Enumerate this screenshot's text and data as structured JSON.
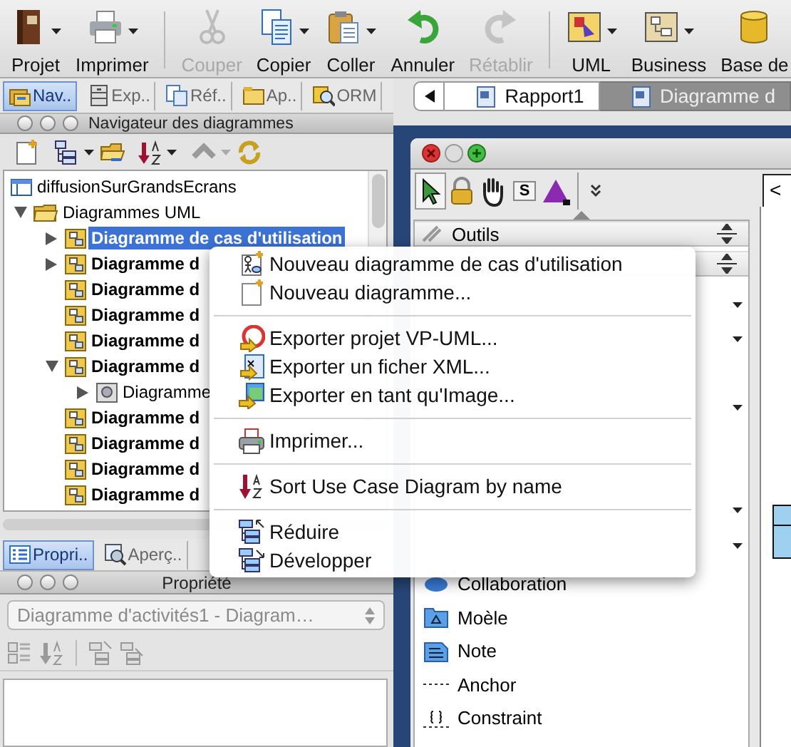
{
  "toolbar": {
    "items": [
      {
        "kind": "button",
        "label": "Projet",
        "disabled": false,
        "dropdown": true
      },
      {
        "kind": "button",
        "label": "Imprimer",
        "disabled": false,
        "dropdown": true
      },
      {
        "kind": "separator"
      },
      {
        "kind": "button",
        "label": "Couper",
        "disabled": true,
        "dropdown": false
      },
      {
        "kind": "button",
        "label": "Copier",
        "disabled": false,
        "dropdown": true
      },
      {
        "kind": "button",
        "label": "Coller",
        "disabled": false,
        "dropdown": true
      },
      {
        "kind": "button",
        "label": "Annuler",
        "disabled": false,
        "dropdown": false
      },
      {
        "kind": "button",
        "label": "Rétablir",
        "disabled": true,
        "dropdown": false
      },
      {
        "kind": "separator"
      },
      {
        "kind": "button",
        "label": "UML",
        "disabled": false,
        "dropdown": true
      },
      {
        "kind": "button",
        "label": "Business",
        "disabled": false,
        "dropdown": true
      },
      {
        "kind": "button",
        "label": "Base de",
        "disabled": false,
        "dropdown": false
      }
    ]
  },
  "panel_tabs": [
    {
      "label": "Nav..",
      "selected": true
    },
    {
      "label": "Exp..",
      "selected": false
    },
    {
      "label": "Réf..",
      "selected": false
    },
    {
      "label": "Ap..",
      "selected": false
    },
    {
      "label": "ORM",
      "selected": false
    }
  ],
  "document_tabs": [
    {
      "label": "Rapport1",
      "selected": false
    },
    {
      "label": "Diagramme d",
      "selected": true
    }
  ],
  "navigator": {
    "title": "Navigateur des diagrammes",
    "tree": [
      {
        "kind": "project",
        "label": "diffusionSurGrandsEcrans",
        "selected": false,
        "children": [
          {
            "kind": "folder",
            "label": "Diagrammes UML",
            "expandable": true,
            "expanded": true,
            "selected": false,
            "children": [
              {
                "kind": "category",
                "label": "Diagramme de cas d'utilisation",
                "expandable": true,
                "expanded": false,
                "selected": true
              },
              {
                "kind": "category",
                "label": "Diagramme d",
                "expandable": true,
                "expanded": false,
                "selected": false
              },
              {
                "kind": "category",
                "label": "Diagramme d",
                "expandable": false,
                "expanded": false,
                "selected": false
              },
              {
                "kind": "category",
                "label": "Diagramme d",
                "expandable": false,
                "expanded": false,
                "selected": false
              },
              {
                "kind": "category",
                "label": "Diagramme d",
                "expandable": false,
                "expanded": false,
                "selected": false
              },
              {
                "kind": "category",
                "label": "Diagramme d",
                "expandable": true,
                "expanded": true,
                "selected": false,
                "children": [
                  {
                    "kind": "diagram",
                    "label": "Diagramme",
                    "expandable": true,
                    "expanded": false,
                    "selected": false
                  }
                ]
              },
              {
                "kind": "category",
                "label": "Diagramme d",
                "expandable": false,
                "expanded": false,
                "selected": false
              },
              {
                "kind": "category",
                "label": "Diagramme d",
                "expandable": false,
                "expanded": false,
                "selected": false
              },
              {
                "kind": "category",
                "label": "Diagramme d",
                "expandable": false,
                "expanded": false,
                "selected": false
              },
              {
                "kind": "category",
                "label": "Diagramme d",
                "expandable": false,
                "expanded": false,
                "selected": false
              }
            ]
          }
        ]
      }
    ]
  },
  "properties": {
    "tabs": [
      {
        "label": "Propri..",
        "selected": true
      },
      {
        "label": "Aperç..",
        "selected": false
      }
    ],
    "title": "Propriété",
    "selector": {
      "value": "Diagramme d'activités1 - Diagram…",
      "disabled": true
    }
  },
  "diagram_window": {
    "tools": [
      {
        "selected": true
      },
      {
        "selected": false
      },
      {
        "selected": false
      },
      {
        "label": "S",
        "selected": false
      },
      {
        "selected": false
      }
    ],
    "palette": {
      "header": "Outils",
      "items": [
        "Collaboration",
        "Moèle",
        "Note",
        "Anchor",
        "Constraint"
      ]
    },
    "field_value": "<"
  },
  "context_menu": {
    "items": [
      {
        "kind": "item",
        "label": "Nouveau diagramme de cas d'utilisation"
      },
      {
        "kind": "item",
        "label": "Nouveau diagramme..."
      },
      {
        "kind": "separator"
      },
      {
        "kind": "item",
        "label": "Exporter projet VP-UML..."
      },
      {
        "kind": "item",
        "label": "Exporter un ficher XML..."
      },
      {
        "kind": "item",
        "label": "Exporter en tant qu'Image..."
      },
      {
        "kind": "separator"
      },
      {
        "kind": "item",
        "label": "Imprimer..."
      },
      {
        "kind": "separator"
      },
      {
        "kind": "item",
        "label": "Sort Use Case Diagram by name"
      },
      {
        "kind": "separator"
      },
      {
        "kind": "item",
        "label": "Réduire"
      },
      {
        "kind": "item",
        "label": "Développer"
      }
    ]
  }
}
